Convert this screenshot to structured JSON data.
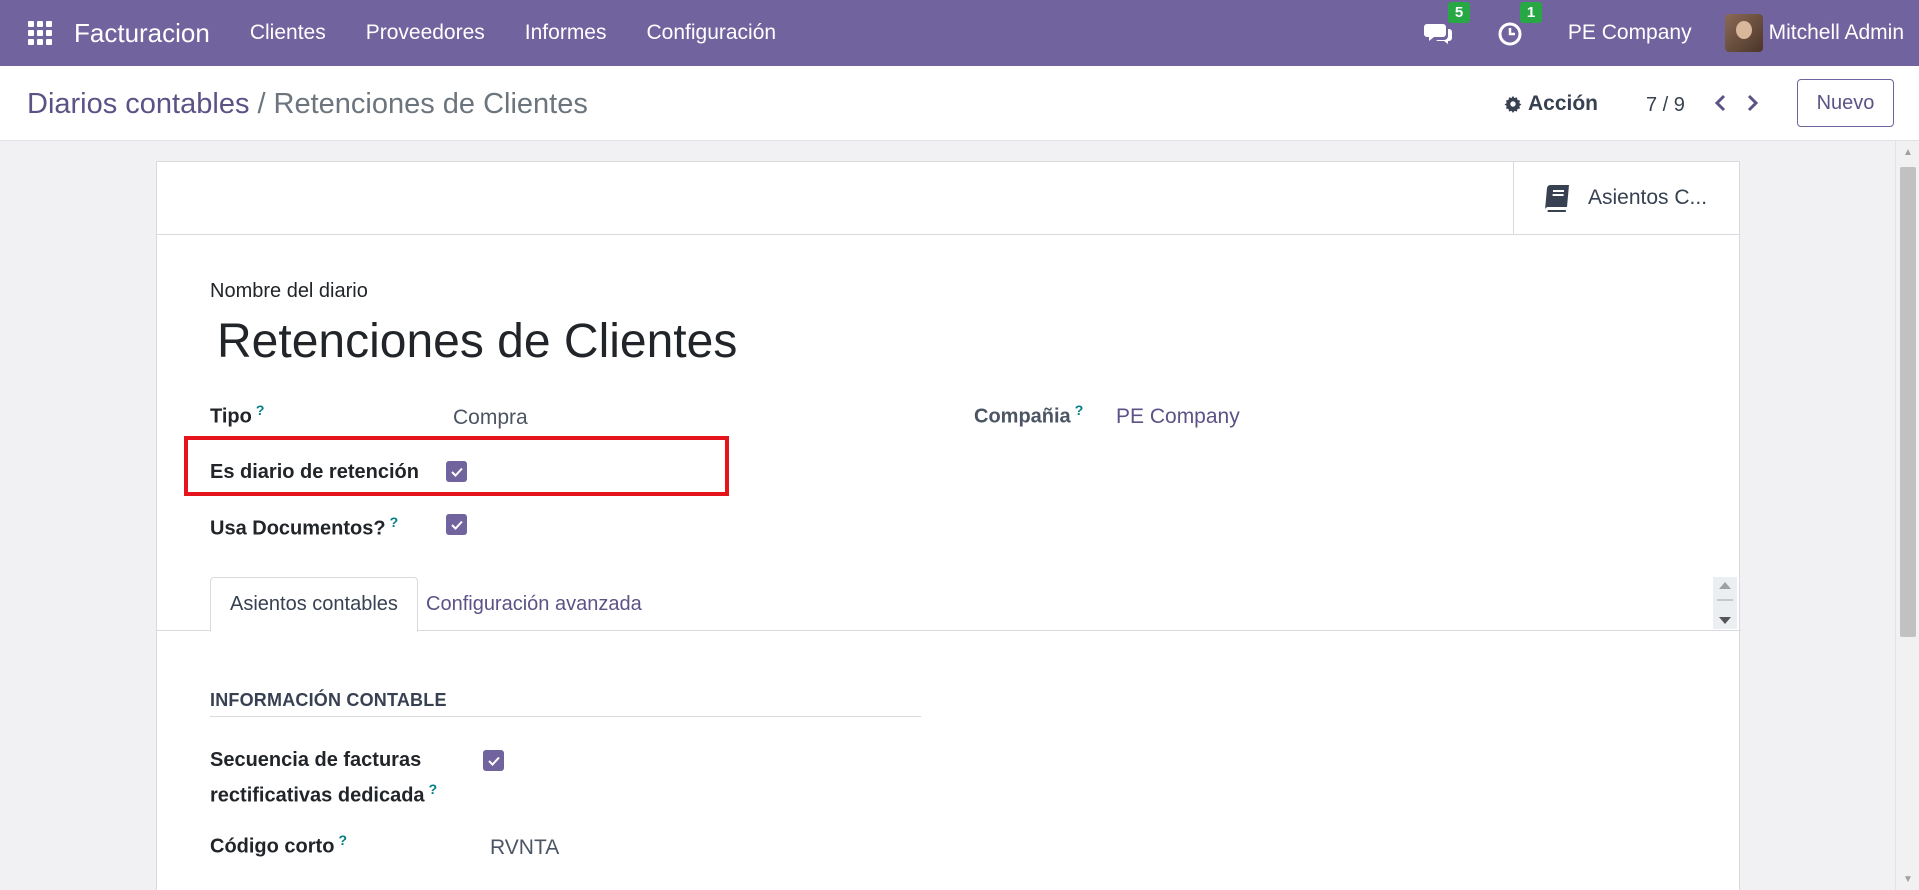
{
  "navbar": {
    "app_name": "Facturacion",
    "menu": [
      "Clientes",
      "Proveedores",
      "Informes",
      "Configuración"
    ],
    "messages_badge": "5",
    "activities_badge": "1",
    "company": "PE Company",
    "user": "Mitchell Admin",
    "color": "#71639e"
  },
  "control_panel": {
    "breadcrumb_parent": "Diarios contables",
    "breadcrumb_separator": "/",
    "breadcrumb_current": "Retenciones de Clientes",
    "action_label": "Acción",
    "pager": "7 / 9",
    "new_label": "Nuevo"
  },
  "smart_buttons": {
    "journal_entries": "Asientos C..."
  },
  "form": {
    "name_label": "Nombre del diario",
    "name_value": "Retenciones de Clientes",
    "type_label": "Tipo",
    "type_help": "?",
    "type_value": "Compra",
    "company_label": "Compañia",
    "company_help": "?",
    "company_value": "PE Company",
    "withholding_label": "Es diario de retención",
    "withholding_checked": true,
    "use_documents_label": "Usa Documentos?",
    "use_documents_help": "?",
    "use_documents_checked": true
  },
  "tabs": {
    "active": "Asientos contables",
    "inactive": "Configuración avanzada"
  },
  "section": {
    "title": "INFORMACIÓN CONTABLE",
    "refund_sequence_label_1": "Secuencia de facturas",
    "refund_sequence_label_2": "rectificativas dedicada",
    "refund_sequence_help": "?",
    "refund_sequence_checked": true,
    "short_code_label": "Código corto",
    "short_code_help": "?",
    "short_code_value": "RVNTA"
  },
  "highlight_color": "#e5131b"
}
